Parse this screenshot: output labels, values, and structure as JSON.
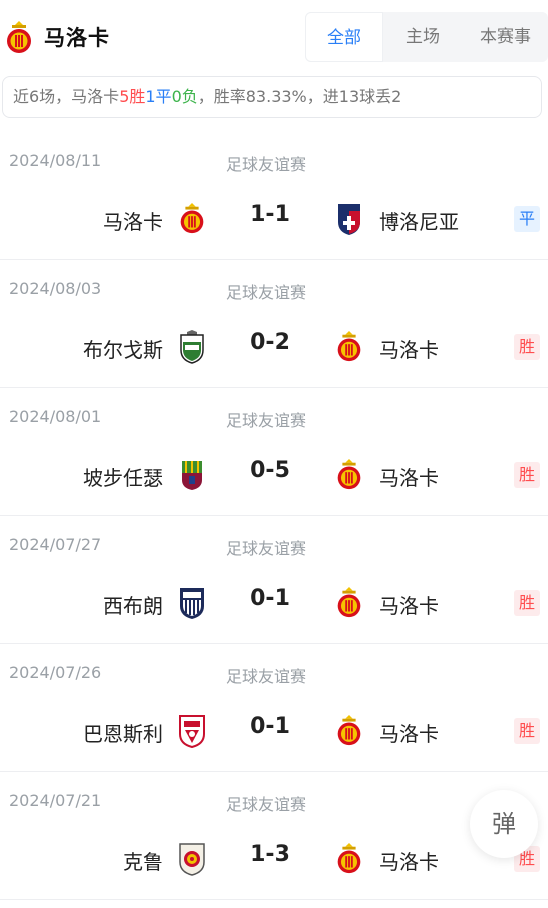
{
  "header": {
    "team_name": "马洛卡",
    "team_logo_icon": "mallorca-crest-icon",
    "tabs": [
      {
        "label": "全部",
        "active": true
      },
      {
        "label": "主场",
        "active": false
      },
      {
        "label": "本赛事",
        "active": false
      }
    ]
  },
  "summary": {
    "part1": "近6场，马洛卡",
    "wins": "5胜",
    "draws": "1平",
    "losses": "0负",
    "part2": "，胜率83.33%，进13球丢2"
  },
  "matches": [
    {
      "date": "2024/08/11",
      "competition": "足球友谊赛",
      "home": "马洛卡",
      "home_logo": "mallorca-crest-icon",
      "score": "1-1",
      "away": "博洛尼亚",
      "away_logo": "bologna-crest-icon",
      "result": "平",
      "result_type": "draw"
    },
    {
      "date": "2024/08/03",
      "competition": "足球友谊赛",
      "home": "布尔戈斯",
      "home_logo": "burgos-crest-icon",
      "score": "0-2",
      "away": "马洛卡",
      "away_logo": "mallorca-crest-icon",
      "result": "胜",
      "result_type": "win"
    },
    {
      "date": "2024/08/01",
      "competition": "足球友谊赛",
      "home": "坡步任瑟",
      "home_logo": "poble-crest-icon",
      "score": "0-5",
      "away": "马洛卡",
      "away_logo": "mallorca-crest-icon",
      "result": "胜",
      "result_type": "win"
    },
    {
      "date": "2024/07/27",
      "competition": "足球友谊赛",
      "home": "西布朗",
      "home_logo": "west-brom-crest-icon",
      "score": "0-1",
      "away": "马洛卡",
      "away_logo": "mallorca-crest-icon",
      "result": "胜",
      "result_type": "win"
    },
    {
      "date": "2024/07/26",
      "competition": "足球友谊赛",
      "home": "巴恩斯利",
      "home_logo": "barnsley-crest-icon",
      "score": "0-1",
      "away": "马洛卡",
      "away_logo": "mallorca-crest-icon",
      "result": "胜",
      "result_type": "win"
    },
    {
      "date": "2024/07/21",
      "competition": "足球友谊赛",
      "home": "克鲁",
      "home_logo": "crewe-crest-icon",
      "score": "1-3",
      "away": "马洛卡",
      "away_logo": "mallorca-crest-icon",
      "result": "胜",
      "result_type": "win"
    }
  ],
  "float_button": {
    "label": "弹"
  },
  "colors": {
    "accent": "#2a7ff6",
    "win": "#ff4d4f",
    "draw": "#2a7ff6",
    "loss": "#3cb34b",
    "muted": "#9aa0a6"
  }
}
